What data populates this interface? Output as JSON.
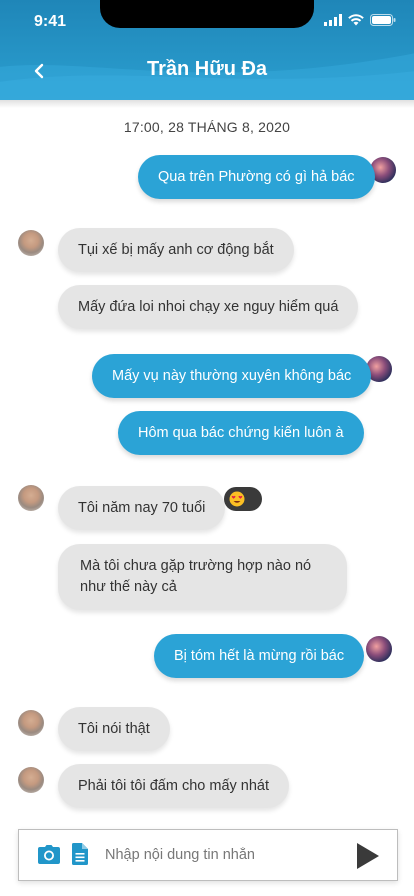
{
  "status": {
    "time": "9:41"
  },
  "header": {
    "title": "Trần Hữu Đa"
  },
  "date_label": "17:00, 28 THÁNG 8, 2020",
  "messages": [
    {
      "from": "me",
      "text": "Qua trên Phường có gì hả bác"
    },
    {
      "from": "other",
      "text": "Tụi xế bị mấy anh cơ động bắt"
    },
    {
      "from": "other",
      "text": "Mấy đứa loi nhoi chạy xe nguy hiểm quá"
    },
    {
      "from": "me",
      "text": "Mấy vụ này thường xuyên không bác"
    },
    {
      "from": "me",
      "text": "Hôm qua bác chứng kiến luôn à"
    },
    {
      "from": "other",
      "text": "Tôi năm nay 70 tuổi",
      "reaction": "heart-eyes"
    },
    {
      "from": "other",
      "text": "Mà tôi chưa gặp trường hợp nào nó như thế này cả"
    },
    {
      "from": "me",
      "text": "Bị tóm hết là mừng rồi bác"
    },
    {
      "from": "other",
      "text": "Tôi nói thật"
    },
    {
      "from": "other",
      "text": "Phải tôi tôi đấm cho mấy nhát"
    }
  ],
  "composer": {
    "placeholder": "Nhập nội dung tin nhắn"
  },
  "colors": {
    "header": "#2b9fd0",
    "outgoing": "#2ba3d6",
    "incoming": "#e5e5e5"
  },
  "icons": [
    "back-arrow-icon",
    "camera-icon",
    "document-icon",
    "send-icon",
    "signal-icon",
    "wifi-icon",
    "battery-icon"
  ]
}
